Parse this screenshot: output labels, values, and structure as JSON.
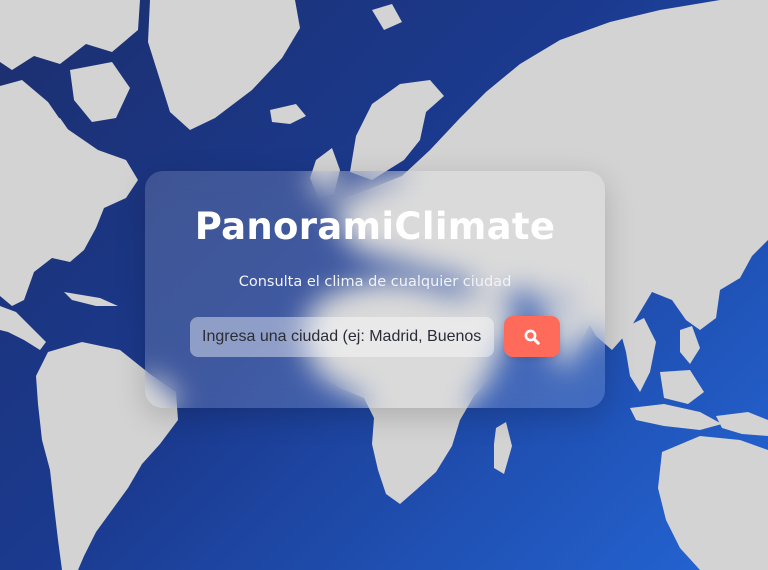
{
  "app": {
    "title": "PanoramiClimate",
    "subtitle": "Consulta el clima de cualquier ciudad"
  },
  "search": {
    "placeholder": "Ingresa una ciudad (ej: Madrid, Buenos Aires)",
    "value": "",
    "button_icon": "search-icon"
  },
  "background": {
    "icon": "world-map",
    "gradient_start": "#1c2f6e",
    "gradient_end": "#2466d6",
    "land_color": "#d3d3d3"
  },
  "colors": {
    "accent": "#ff6b5b",
    "title": "#ffffff"
  }
}
